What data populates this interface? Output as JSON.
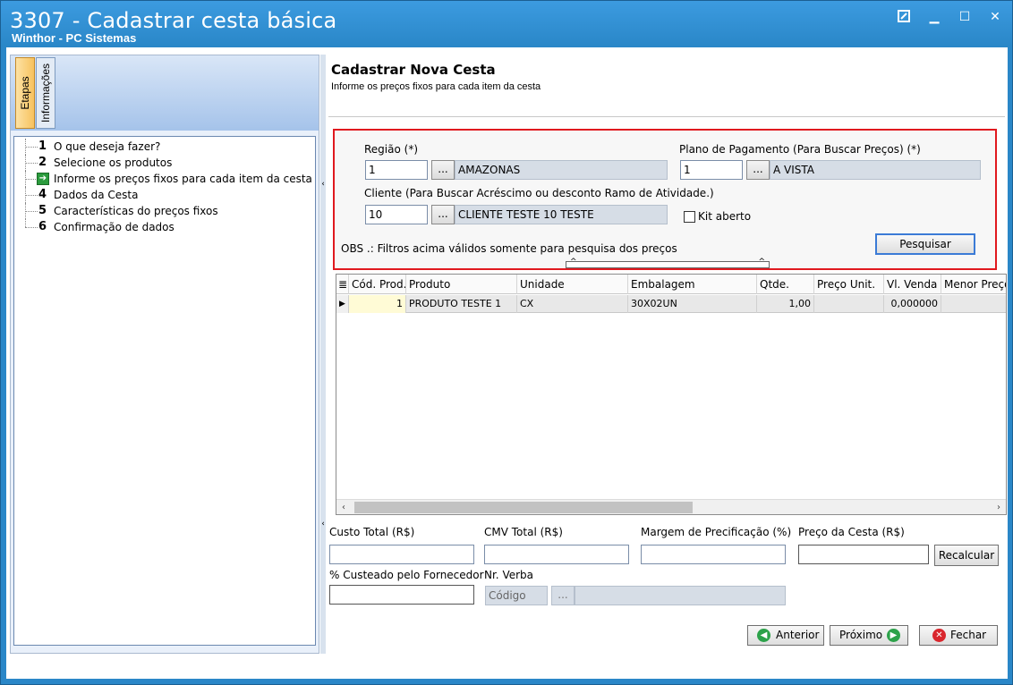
{
  "window": {
    "title": "3307 - Cadastrar cesta básica",
    "subtitle": "Winthor - PC Sistemas",
    "controls": {
      "restore_icon": "resize-icon",
      "minimize": "▁",
      "maximize": "☐",
      "close": "✕"
    }
  },
  "sidebar": {
    "tabs": {
      "active": "Etapas",
      "inactive": "Informações"
    },
    "steps": [
      {
        "num": "1",
        "label": "O que deseja fazer?"
      },
      {
        "num": "2",
        "label": "Selecione os produtos"
      },
      {
        "num": "",
        "label": "Informe os preços fixos para cada item da cesta",
        "current": true
      },
      {
        "num": "4",
        "label": "Dados da Cesta"
      },
      {
        "num": "5",
        "label": "Características do preços fixos"
      },
      {
        "num": "6",
        "label": "Confirmação de dados"
      }
    ]
  },
  "main": {
    "title": "Cadastrar Nova Cesta",
    "description": "Informe os preços fixos para cada item da cesta"
  },
  "filters": {
    "regiao_label": "Região (*)",
    "regiao_code": "1",
    "regiao_name": "AMAZONAS",
    "plano_label": "Plano de Pagamento (Para Buscar Preços) (*)",
    "plano_code": "1",
    "plano_name": "A VISTA",
    "cliente_label": "Cliente (Para Buscar Acréscimo ou desconto Ramo de Atividade.)",
    "cliente_code": "10",
    "cliente_name": "CLIENTE TESTE 10 TESTE",
    "kit_label": "Kit aberto",
    "obs": "OBS .: Filtros acima válidos somente para pesquisa dos preços",
    "search_button": "Pesquisar",
    "lookup_button": "..."
  },
  "grid": {
    "columns": [
      "Cód. Prod.",
      "Produto",
      "Unidade",
      "Embalagem",
      "Qtde.",
      "Preço Unit.",
      "Vl. Venda",
      "Menor Preço"
    ],
    "rows": [
      {
        "cod": "1",
        "produto": "PRODUTO TESTE 1",
        "unidade": "CX",
        "embalagem": "30X02UN",
        "qtde": "1,00",
        "preco_unit": "",
        "vl_venda": "0,000000",
        "menor_preco": ""
      }
    ]
  },
  "totals": {
    "custo_label": "Custo Total (R$)",
    "cmv_label": "CMV Total (R$)",
    "margem_label": "Margem de Precificação (%)",
    "preco_label": "Preço da Cesta (R$)",
    "recalc_button": "Recalcular",
    "custeado_label": "% Custeado pelo Fornecedor",
    "verba_label": "Nr. Verba",
    "verba_placeholder": "Código",
    "verba_lookup": "..."
  },
  "nav": {
    "anterior": "Anterior",
    "proximo": "Próximo",
    "fechar": "Fechar"
  },
  "colors": {
    "title_bar": "#2a87c8",
    "filter_border": "#e0191f",
    "active_tab": "#f7c25e"
  }
}
